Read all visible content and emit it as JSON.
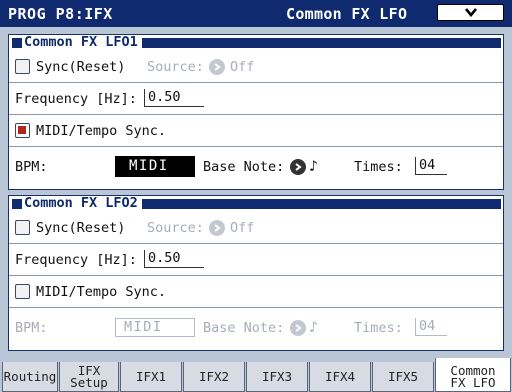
{
  "header": {
    "title": "PROG P8:IFX",
    "page_name": "Common FX LFO",
    "menu_icon": "chevron-down-icon"
  },
  "lfo1": {
    "title": "Common FX LFO1",
    "sync_label": "Sync(Reset)",
    "source_label": "Source:",
    "source_value": "Off",
    "sync_checked": false,
    "freq_label": "Frequency [Hz]:",
    "freq_value": "0.50",
    "midi_sync_label": "MIDI/Tempo Sync.",
    "midi_sync_checked": true,
    "bpm_label": "BPM:",
    "bpm_value": "MIDI",
    "base_note_label": "Base Note:",
    "base_note_symbol": "♪",
    "times_label": "Times:",
    "times_value": "04"
  },
  "lfo2": {
    "title": "Common FX LFO2",
    "sync_label": "Sync(Reset)",
    "source_label": "Source:",
    "source_value": "Off",
    "sync_checked": false,
    "freq_label": "Frequency [Hz]:",
    "freq_value": "0.50",
    "midi_sync_label": "MIDI/Tempo Sync.",
    "midi_sync_checked": false,
    "bpm_label": "BPM:",
    "bpm_value": "MIDI",
    "base_note_label": "Base Note:",
    "base_note_symbol": "♪",
    "times_label": "Times:",
    "times_value": "04"
  },
  "tabs": [
    {
      "line1": "Routing",
      "line2": ""
    },
    {
      "line1": "IFX",
      "line2": "Setup"
    },
    {
      "line1": "IFX1",
      "line2": ""
    },
    {
      "line1": "IFX2",
      "line2": ""
    },
    {
      "line1": "IFX3",
      "line2": ""
    },
    {
      "line1": "IFX4",
      "line2": ""
    },
    {
      "line1": "IFX5",
      "line2": ""
    },
    {
      "line1": "Common",
      "line2": "FX LFO"
    }
  ],
  "active_tab": "Common FX LFO",
  "colors": {
    "title_bar": "#0f2a6e",
    "background": "#b9c6d6",
    "checkbox_checked": "#b3261e"
  }
}
